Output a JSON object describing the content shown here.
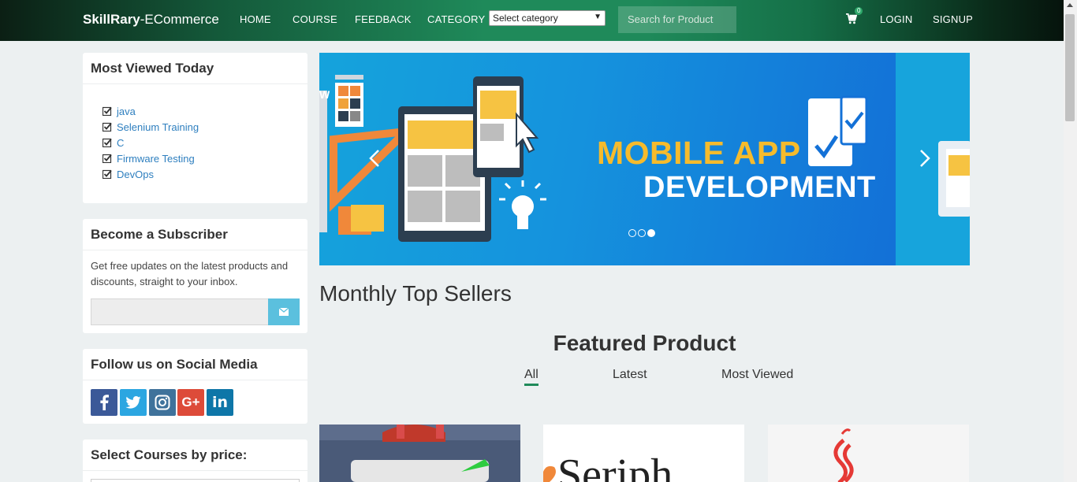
{
  "navbar": {
    "brand_bold": "SkillRary",
    "brand_rest": "-ECommerce",
    "links": [
      "HOME",
      "COURSE",
      "FEEDBACK",
      "CATEGORY"
    ],
    "category_select": "Select category",
    "search_placeholder": "Search for Product",
    "cart_count": "0",
    "login": "LOGIN",
    "signup": "SIGNUP"
  },
  "most_viewed": {
    "title": "Most Viewed Today",
    "items": [
      "java",
      "Selenium Training",
      "C",
      "Firmware Testing",
      "DevOps"
    ]
  },
  "subscriber": {
    "title": "Become a Subscriber",
    "text": "Get free updates on the latest products and discounts, straight to your inbox."
  },
  "social": {
    "title": "Follow us on Social Media",
    "networks": [
      "facebook",
      "twitter",
      "instagram",
      "google-plus",
      "linkedin"
    ]
  },
  "price_filter": {
    "title": "Select Courses by price:"
  },
  "banner": {
    "line1": "MOBILE APP",
    "line2": "DEVELOPMENT",
    "slide_count": 3,
    "active_slide": 3
  },
  "main": {
    "top_sellers": "Monthly Top Sellers",
    "featured": "Featured Product",
    "tabs": [
      "All",
      "Latest",
      "Most Viewed"
    ]
  },
  "colors": {
    "accent": "#1f8a5a",
    "link": "#2e7fbf",
    "banner_yellow": "#f6bb2c"
  }
}
